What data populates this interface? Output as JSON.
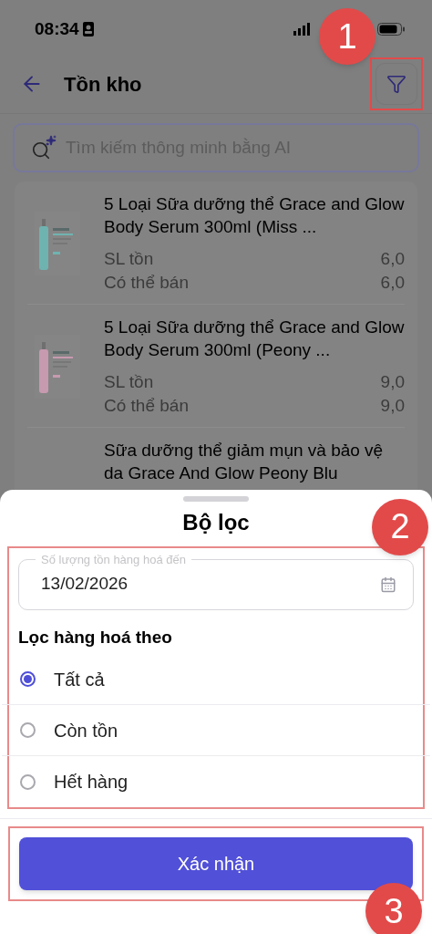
{
  "status_bar": {
    "time": "08:34"
  },
  "header": {
    "title": "Tồn kho"
  },
  "search": {
    "placeholder": "Tìm kiếm thông minh bằng AI"
  },
  "products": [
    {
      "name": "5 Loại Sữa dưỡng thể Grace and Glow Body Serum 300ml (Miss ...",
      "color": "#6fb3b0",
      "stats": [
        {
          "label": "SL tồn",
          "value": "6,0"
        },
        {
          "label": "Có thể bán",
          "value": "6,0"
        }
      ]
    },
    {
      "name": "5 Loại Sữa dưỡng thể Grace and Glow Body Serum 300ml (Peony ...",
      "color": "#c79ab0",
      "stats": [
        {
          "label": "SL tồn",
          "value": "9,0"
        },
        {
          "label": "Có thể bán",
          "value": "9,0"
        }
      ]
    },
    {
      "name": "Sữa dưỡng thể giảm mụn và bảo vệ da Grace And Glow Peony Blu"
    }
  ],
  "filter_sheet": {
    "title": "Bộ lọc",
    "date_field": {
      "label": "Số lượng tồn hàng hoá đến",
      "value": "13/02/2026"
    },
    "group_label": "Lọc hàng hoá theo",
    "options": [
      {
        "label": "Tất cả",
        "selected": true
      },
      {
        "label": "Còn tồn",
        "selected": false
      },
      {
        "label": "Hết hàng",
        "selected": false
      }
    ],
    "confirm_button": "Xác nhận"
  },
  "annotations": [
    {
      "label": "1"
    },
    {
      "label": "2"
    },
    {
      "label": "3"
    }
  ]
}
